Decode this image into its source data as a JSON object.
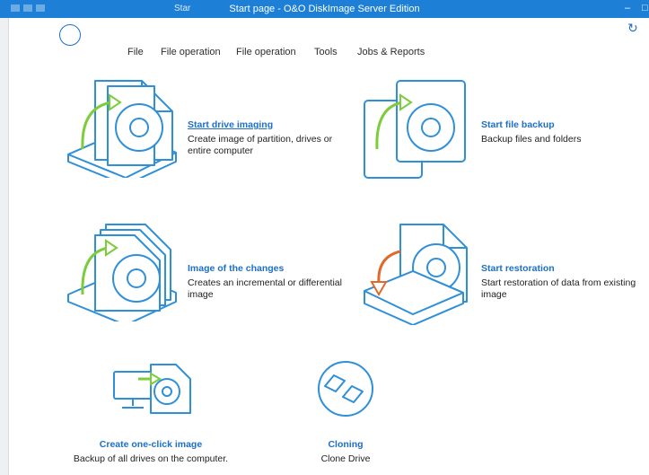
{
  "window": {
    "tab_label": "Star",
    "title": "Start page - O&O DiskImage Server Edition"
  },
  "menu": {
    "items": [
      "File",
      "File operation",
      "File operation",
      "Tools",
      "Jobs & Reports"
    ]
  },
  "colors": {
    "accent": "#1d6fc8",
    "icon_stroke": "#2f8fd8",
    "green_arrow": "#7ccc3c",
    "orange_arrow": "#e06a2c",
    "titlebar": "#1e7fd6"
  },
  "tiles": {
    "start_drive_imaging": {
      "title": "Start drive imaging",
      "description": "Create image of partition, drives or entire computer"
    },
    "start_file_backup": {
      "title": "Start file backup",
      "description": "Backup files and folders"
    },
    "image_of_changes": {
      "title": "Image of the changes",
      "description": "Creates an incremental or differential image"
    },
    "start_restoration": {
      "title": "Start restoration",
      "description": "Start restoration of data from existing image"
    },
    "one_click_image": {
      "title": "Create one-click image",
      "description": "Backup of all drives on the computer."
    },
    "cloning": {
      "title": "Cloning",
      "description": "Clone Drive"
    }
  }
}
